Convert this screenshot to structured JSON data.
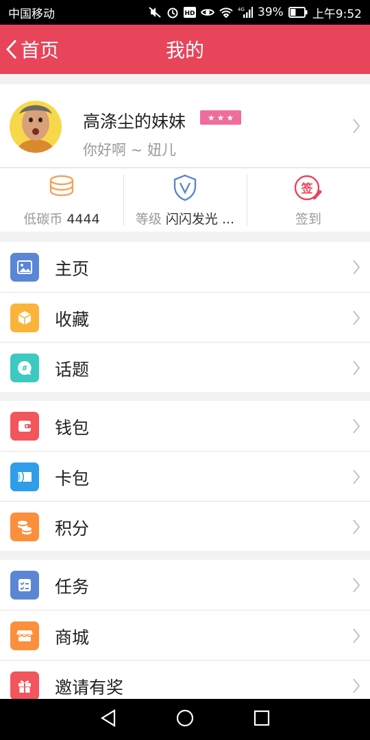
{
  "status_bar": {
    "carrier": "中国移动",
    "network": "4G",
    "battery": "39%",
    "time": "上午9:52"
  },
  "header": {
    "back_label": "首页",
    "title": "我的"
  },
  "profile": {
    "name": "高涤尘的妹妹",
    "signature": "你好啊 ~ 妞儿",
    "stars": 3
  },
  "stats": [
    {
      "icon": "coins-stack-icon",
      "label": "低碳币",
      "value": "4444",
      "color": "#f5a15a"
    },
    {
      "icon": "shield-v-icon",
      "label": "等级",
      "value": "闪闪发光 ...",
      "color": "#5b86c9"
    },
    {
      "icon": "sign-in-icon",
      "label": "签到",
      "value": "",
      "color": "#e8445a"
    }
  ],
  "sign_glyph": "签",
  "menu_groups": [
    [
      {
        "icon": "image-icon",
        "label": "主页",
        "color": "#5b86d6"
      },
      {
        "icon": "cube-icon",
        "label": "收藏",
        "color": "#fbb33a"
      },
      {
        "icon": "topic-bubble-icon",
        "label": "话题",
        "color": "#3cc9c0"
      }
    ],
    [
      {
        "icon": "wallet-icon",
        "label": "钱包",
        "color": "#f2555c"
      },
      {
        "icon": "card-icon",
        "label": "卡包",
        "color": "#2f9de8"
      },
      {
        "icon": "points-coins-icon",
        "label": "积分",
        "color": "#fb8f3c"
      }
    ],
    [
      {
        "icon": "task-list-icon",
        "label": "任务",
        "color": "#5b86d6"
      },
      {
        "icon": "store-icon",
        "label": "商城",
        "color": "#fb8f3c"
      },
      {
        "icon": "gift-icon",
        "label": "邀请有奖",
        "color": "#f2555c"
      }
    ]
  ]
}
